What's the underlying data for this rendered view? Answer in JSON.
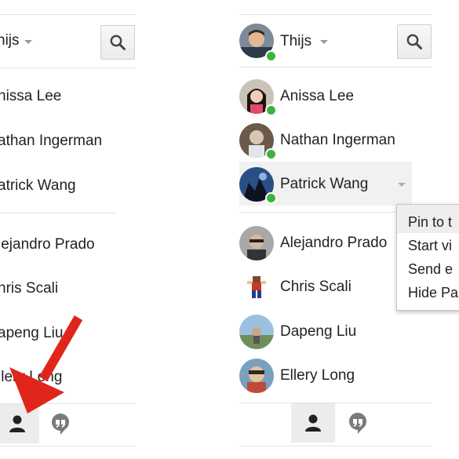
{
  "left_panel": {
    "user_name": "hijs",
    "contacts": [
      {
        "name": "nissa Lee"
      },
      {
        "name": "athan Ingerman"
      },
      {
        "name": "atrick Wang"
      }
    ],
    "offline_contacts": [
      {
        "name": "lejandro Prado"
      },
      {
        "name": "hris Scali"
      },
      {
        "name": "apeng Liu"
      },
      {
        "name": "llery Long"
      }
    ]
  },
  "right_panel": {
    "user_name": "Thijs",
    "contacts": [
      {
        "name": "Anissa Lee"
      },
      {
        "name": "Nathan Ingerman"
      },
      {
        "name": "Patrick Wang"
      }
    ],
    "offline_contacts": [
      {
        "name": "Alejandro Prado"
      },
      {
        "name": "Chris Scali"
      },
      {
        "name": "Dapeng Liu"
      },
      {
        "name": "Ellery Long"
      }
    ]
  },
  "context_menu": {
    "items": [
      "Pin to t",
      "Start vi",
      "Send e",
      "Hide Pa"
    ]
  },
  "colors": {
    "online_dot": "#3cb43c",
    "annotation_arrow": "#e0261b"
  },
  "icons": [
    "search-icon",
    "person-icon",
    "quote-bubble-icon",
    "chevron-down-icon",
    "arrow-annotation"
  ]
}
